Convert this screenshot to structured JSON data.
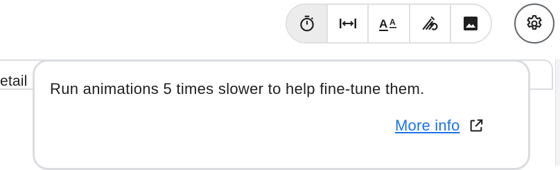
{
  "toolbar": {
    "tools": [
      {
        "name": "timer-icon",
        "tooltip": "Slow animations"
      },
      {
        "name": "width-arrows-icon",
        "tooltip": "Layout bounds"
      },
      {
        "name": "text-size-icon",
        "tooltip": "Text scaling"
      },
      {
        "name": "repaint-icon",
        "tooltip": "Repaint rainbow"
      },
      {
        "name": "image-icon",
        "tooltip": "Invert oversized images"
      }
    ],
    "active_index": 0
  },
  "settings": {
    "icon": "gear-icon"
  },
  "background": {
    "tab_label": "etail"
  },
  "tooltip": {
    "message": "Run animations 5 times slower to help fine-tune them.",
    "link_label": "More info",
    "link_icon": "open-in-new-icon"
  },
  "colors": {
    "link": "#1a73e8",
    "border": "#dadce0",
    "active_tool": "#ececec"
  }
}
